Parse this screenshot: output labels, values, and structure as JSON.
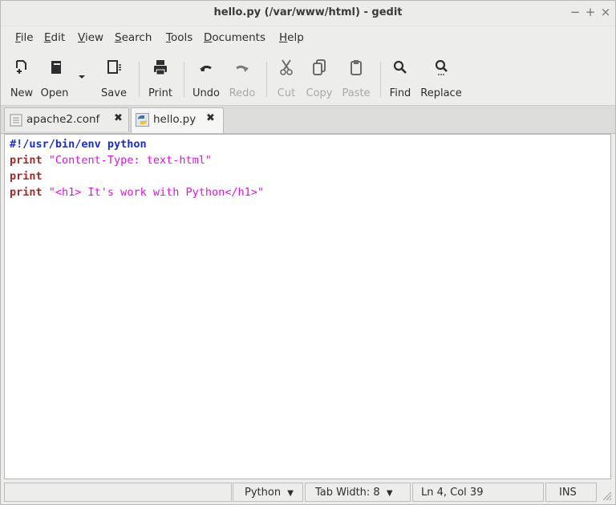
{
  "window": {
    "title": "hello.py (/var/www/html) - gedit",
    "controls": {
      "minimize": "−",
      "maximize": "+",
      "close": "×"
    }
  },
  "menu": {
    "file": {
      "u": "F",
      "rest": "ile"
    },
    "edit": {
      "u": "E",
      "rest": "dit"
    },
    "view": {
      "u": "V",
      "rest": "iew"
    },
    "search": {
      "u": "S",
      "rest": "earch"
    },
    "tools": {
      "u": "T",
      "rest": "ools"
    },
    "documents": {
      "u": "D",
      "rest": "ocuments"
    },
    "help": {
      "u": "H",
      "rest": "elp"
    }
  },
  "toolbar": {
    "new": "New",
    "open": "Open",
    "save": "Save",
    "print": "Print",
    "undo": "Undo",
    "redo": "Redo",
    "cut": "Cut",
    "copy": "Copy",
    "paste": "Paste",
    "find": "Find",
    "replace": "Replace"
  },
  "tabs": [
    {
      "label": "apache2.conf",
      "icon": "text-file-icon",
      "close": "✖",
      "active": false
    },
    {
      "label": "hello.py",
      "icon": "python-file-icon",
      "close": "✖",
      "active": true
    }
  ],
  "editor": {
    "line1": "#!/usr/bin/env python",
    "line2_kw": "print",
    "line2_str": "\"Content-Type: text-html\"",
    "line3_kw": "print",
    "line4_kw": "print",
    "line4_str": "\"<h1> It's work with Python</h1>\""
  },
  "status": {
    "language": "Python",
    "tab_width": "Tab Width:  8",
    "cursor": "Ln 4, Col 39",
    "mode": "INS",
    "dropdown_arrow": "▼"
  },
  "colors": {
    "shebang": "#1b2fc6",
    "keyword": "#a52a2a",
    "string": "#e310e3"
  }
}
